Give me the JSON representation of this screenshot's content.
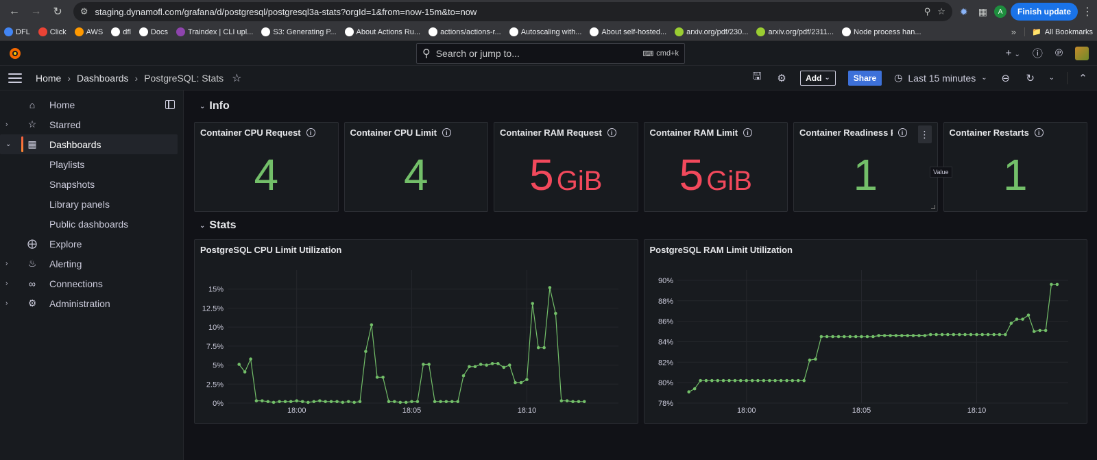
{
  "browser": {
    "url": "staging.dynamofl.com/grafana/d/postgresql/postgresql3a-stats?orgId=1&from=now-15m&to=now",
    "profile_initial": "A",
    "finish_update": "Finish update",
    "bookmarks": [
      {
        "label": "DFL",
        "color": "#4285f4"
      },
      {
        "label": "Click",
        "color": "#ea4335"
      },
      {
        "label": "AWS",
        "color": "#ff9900"
      },
      {
        "label": "dfl",
        "color": "#ffffff"
      },
      {
        "label": "Docs",
        "color": "#ffffff"
      },
      {
        "label": "Traindex | CLI upl...",
        "color": "#8e44ad"
      },
      {
        "label": "S3: Generating P...",
        "color": "#ffffff"
      },
      {
        "label": "About Actions Ru...",
        "color": "#ffffff"
      },
      {
        "label": "actions/actions-r...",
        "color": "#ffffff"
      },
      {
        "label": "Autoscaling with...",
        "color": "#ffffff"
      },
      {
        "label": "About self-hosted...",
        "color": "#ffffff"
      },
      {
        "label": "arxiv.org/pdf/230...",
        "color": "#9acd32"
      },
      {
        "label": "arxiv.org/pdf/2311...",
        "color": "#9acd32"
      },
      {
        "label": "Node process han...",
        "color": "#ffffff"
      }
    ],
    "all_bookmarks": "All Bookmarks"
  },
  "grafana": {
    "search_placeholder": "Search or jump to...",
    "search_shortcut": "cmd+k",
    "breadcrumb": [
      "Home",
      "Dashboards",
      "PostgreSQL: Stats"
    ],
    "add_label": "Add",
    "share_label": "Share",
    "time_range": "Last 15 minutes"
  },
  "sidebar": {
    "items": [
      {
        "label": "Home",
        "icon": "home-icon"
      },
      {
        "label": "Starred",
        "icon": "star-icon"
      },
      {
        "label": "Dashboards",
        "icon": "grid-icon"
      },
      {
        "label": "Playlists"
      },
      {
        "label": "Snapshots"
      },
      {
        "label": "Library panels"
      },
      {
        "label": "Public dashboards"
      },
      {
        "label": "Explore",
        "icon": "compass-icon"
      },
      {
        "label": "Alerting",
        "icon": "bell-icon"
      },
      {
        "label": "Connections",
        "icon": "link-icon"
      },
      {
        "label": "Administration",
        "icon": "gear-icon"
      }
    ]
  },
  "rows": {
    "info": "Info",
    "stats": "Stats"
  },
  "stat_panels": [
    {
      "title": "Container CPU Request",
      "value": "4",
      "unit": "",
      "color": "#73bf69"
    },
    {
      "title": "Container CPU Limit",
      "value": "4",
      "unit": "",
      "color": "#73bf69"
    },
    {
      "title": "Container RAM Request",
      "value": "5",
      "unit": "GiB",
      "color": "#f2495c"
    },
    {
      "title": "Container RAM Limit",
      "value": "5",
      "unit": "GiB",
      "color": "#f2495c"
    },
    {
      "title": "Container Readiness Pro",
      "value": "1",
      "unit": "",
      "color": "#73bf69"
    },
    {
      "title": "Container Restarts",
      "value": "1",
      "unit": "",
      "color": "#73bf69"
    }
  ],
  "tooltip": "Value",
  "chart_data": [
    {
      "type": "line",
      "title": "PostgreSQL CPU Limit Utilization",
      "ylim": [
        0,
        17.5
      ],
      "yticks": [
        0,
        2.5,
        5,
        7.5,
        10,
        12.5,
        15
      ],
      "ytick_labels": [
        "0%",
        "2.5%",
        "5%",
        "7.5%",
        "10%",
        "12.5%",
        "15%"
      ],
      "x_range": [
        17.95,
        18.233
      ],
      "xticks": [
        18.0,
        18.0833,
        18.1667
      ],
      "xtick_labels": [
        "18:00",
        "18:05",
        "18:10"
      ],
      "grid": true,
      "color": "#73bf69",
      "x": [
        17.9583,
        17.9625,
        17.9667,
        17.9708,
        17.975,
        17.9792,
        17.9833,
        17.9875,
        17.9917,
        17.9958,
        18.0,
        18.0042,
        18.0083,
        18.0125,
        18.0167,
        18.0208,
        18.025,
        18.0292,
        18.0333,
        18.0375,
        18.0417,
        18.0458,
        18.05,
        18.0542,
        18.0583,
        18.0625,
        18.0667,
        18.0708,
        18.075,
        18.0792,
        18.0833,
        18.0875,
        18.0917,
        18.0958,
        18.1,
        18.1042,
        18.1083,
        18.1125,
        18.1167,
        18.1208,
        18.125,
        18.1292,
        18.1333,
        18.1375,
        18.1417,
        18.1458,
        18.15,
        18.1542,
        18.1583,
        18.1625,
        18.1667,
        18.1708,
        18.175,
        18.1792,
        18.1833,
        18.1875,
        18.1917,
        18.1958,
        18.2,
        18.2042,
        18.2083,
        18.2125,
        18.2167,
        18.2208,
        18.225
      ],
      "y": [
        5.1,
        4.1,
        5.8,
        0.3,
        0.3,
        0.2,
        0.1,
        0.2,
        0.2,
        0.2,
        0.3,
        0.2,
        0.1,
        0.2,
        0.3,
        0.2,
        0.2,
        0.2,
        0.1,
        0.2,
        0.1,
        0.2,
        6.8,
        10.3,
        3.4,
        3.4,
        0.2,
        0.2,
        0.1,
        0.1,
        0.2,
        0.2,
        5.1,
        5.1,
        0.2,
        0.2,
        0.2,
        0.2,
        0.2,
        3.6,
        4.8,
        4.8,
        5.1,
        5.0,
        5.2,
        5.2,
        4.7,
        5.0,
        2.7,
        2.7,
        3.1,
        13.1,
        7.3,
        7.3,
        15.2,
        11.8,
        0.3,
        0.3,
        0.2,
        0.2,
        0.2
      ]
    },
    {
      "type": "line",
      "title": "PostgreSQL RAM Limit Utilization",
      "ylim": [
        78,
        91
      ],
      "yticks": [
        78,
        80,
        82,
        84,
        86,
        88,
        90
      ],
      "ytick_labels": [
        "78%",
        "80%",
        "82%",
        "84%",
        "86%",
        "88%",
        "90%"
      ],
      "x_range": [
        17.95,
        18.233
      ],
      "xticks": [
        18.0,
        18.0833,
        18.1667
      ],
      "xtick_labels": [
        "18:00",
        "18:05",
        "18:10"
      ],
      "grid": true,
      "color": "#73bf69",
      "x": [
        17.9583,
        17.9625,
        17.9667,
        17.9708,
        17.975,
        17.9792,
        17.9833,
        17.9875,
        17.9917,
        17.9958,
        18.0,
        18.0042,
        18.0083,
        18.0125,
        18.0167,
        18.0208,
        18.025,
        18.0292,
        18.0333,
        18.0375,
        18.0417,
        18.0458,
        18.05,
        18.0542,
        18.0583,
        18.0625,
        18.0667,
        18.0708,
        18.075,
        18.0792,
        18.0833,
        18.0875,
        18.0917,
        18.0958,
        18.1,
        18.1042,
        18.1083,
        18.1125,
        18.1167,
        18.1208,
        18.125,
        18.1292,
        18.1333,
        18.1375,
        18.1417,
        18.1458,
        18.15,
        18.1542,
        18.1583,
        18.1625,
        18.1667,
        18.1708,
        18.175,
        18.1792,
        18.1833,
        18.1875,
        18.1917,
        18.1958,
        18.2,
        18.2042,
        18.2083,
        18.2125,
        18.2167,
        18.2208,
        18.225
      ],
      "y": [
        79.1,
        79.4,
        80.2,
        80.2,
        80.2,
        80.2,
        80.2,
        80.2,
        80.2,
        80.2,
        80.2,
        80.2,
        80.2,
        80.2,
        80.2,
        80.2,
        80.2,
        80.2,
        80.2,
        80.2,
        80.2,
        82.2,
        82.3,
        84.5,
        84.5,
        84.5,
        84.5,
        84.5,
        84.5,
        84.5,
        84.5,
        84.5,
        84.5,
        84.6,
        84.6,
        84.6,
        84.6,
        84.6,
        84.6,
        84.6,
        84.6,
        84.6,
        84.7,
        84.7,
        84.7,
        84.7,
        84.7,
        84.7,
        84.7,
        84.7,
        84.7,
        84.7,
        84.7,
        84.7,
        84.7,
        84.7,
        85.8,
        86.2,
        86.2,
        86.6,
        85.0,
        85.1,
        85.1,
        89.6,
        89.6,
        89.6
      ]
    }
  ]
}
